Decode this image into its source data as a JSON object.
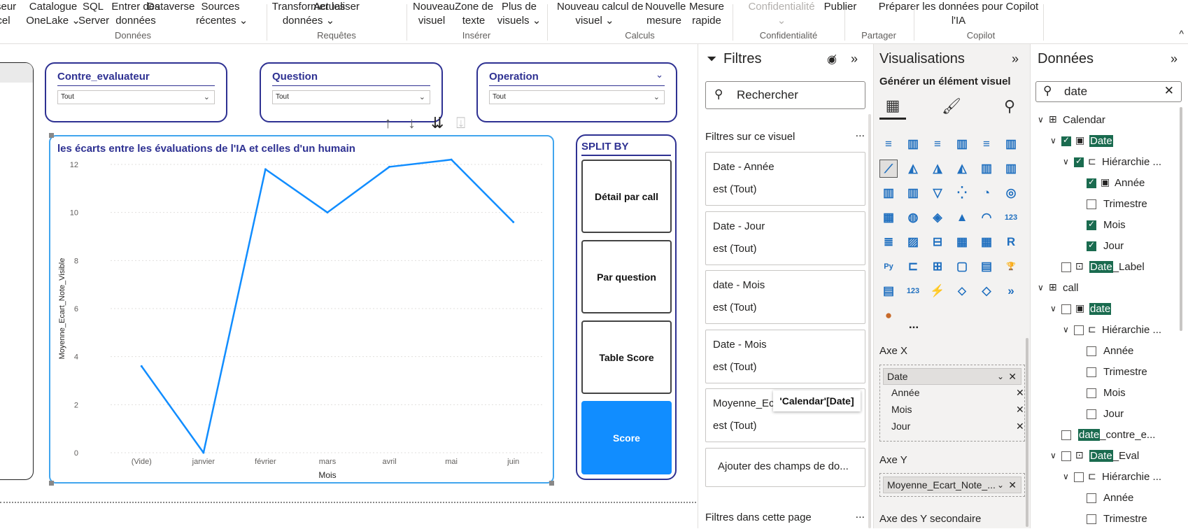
{
  "ribbon": {
    "items": [
      {
        "l1": "seur",
        "l2": "cel",
        "x": 0
      },
      {
        "l1": "Catalogue",
        "l2": "OneLake ⌄"
      },
      {
        "l1": "SQL",
        "l2": "Server"
      },
      {
        "l1": "Entrer des",
        "l2": "données"
      },
      {
        "l1": "Dataverse",
        "l2": ""
      },
      {
        "l1": "Sources",
        "l2": "récentes ⌄"
      },
      {
        "l1": "Transformer les",
        "l2": "données ⌄"
      },
      {
        "l1": "Actualiser",
        "l2": ""
      },
      {
        "l1": "Nouveau",
        "l2": "visuel"
      },
      {
        "l1": "Zone de",
        "l2": "texte"
      },
      {
        "l1": "Plus de",
        "l2": "visuels ⌄"
      },
      {
        "l1": "Nouveau calcul de",
        "l2": "visuel ⌄"
      },
      {
        "l1": "Nouvelle",
        "l2": "mesure"
      },
      {
        "l1": "Mesure",
        "l2": "rapide"
      },
      {
        "l1": "Confidentialité",
        "l2": "⌄"
      },
      {
        "l1": "Publier",
        "l2": ""
      },
      {
        "l1": "Préparer les données pour Copilot",
        "l2": "l'IA"
      }
    ],
    "groups": [
      "Données",
      "Requêtes",
      "Insérer",
      "Calculs",
      "Confidentialité",
      "Partager",
      "Copilot"
    ],
    "collapse_glyph": "^"
  },
  "slicers": [
    {
      "title": "Contre_evaluateur",
      "value": "Tout"
    },
    {
      "title": "Question",
      "value": "Tout"
    },
    {
      "title": "Operation",
      "value": "Tout"
    }
  ],
  "chart_data": {
    "type": "line",
    "title": "les écarts entre les évaluations de l'IA et celles d'un humain",
    "xlabel": "Mois",
    "ylabel": "Moyenne_Ecart_Note_Visible",
    "categories": [
      "(Vide)",
      "janvier",
      "février",
      "mars",
      "avril",
      "mai",
      "juin"
    ],
    "series": [
      {
        "values": [
          3.6,
          0.0,
          11.8,
          10.0,
          11.9,
          12.2,
          9.6
        ],
        "color": "#118dff"
      }
    ],
    "ylim": [
      0,
      12
    ],
    "yticks": [
      0,
      2,
      4,
      6,
      8,
      10,
      12
    ],
    "grid": true
  },
  "splitby": {
    "title": "SPLIT BY",
    "buttons": [
      "Détail par call",
      "Par question",
      "Table Score",
      "Score"
    ],
    "active_index": 3
  },
  "filters": {
    "title": "Filtres",
    "search_placeholder": "Rechercher",
    "section_visual": "Filtres sur ce visuel",
    "cards": [
      {
        "title": "Date - Année",
        "value": "est (Tout)"
      },
      {
        "title": "Date - Jour",
        "value": "est (Tout)"
      },
      {
        "title": "date - Mois",
        "value": "est (Tout)"
      },
      {
        "title": "Date - Mois",
        "value": "est (Tout)"
      },
      {
        "title": "Moyenne_Eca",
        "value": "est (Tout)"
      }
    ],
    "add_fields": "Ajouter des champs de do...",
    "section_page": "Filtres dans cette page",
    "ellipsis": "..."
  },
  "tooltip": "'Calendar'[Date]",
  "viz": {
    "title": "Visualisations",
    "subtitle": "Générer un élément visuel",
    "axis_x_label": "Axe X",
    "axis_x_field": "Date",
    "axis_x_subs": [
      "Année",
      "Mois",
      "Jour"
    ],
    "axis_y_label": "Axe Y",
    "axis_y_field": "Moyenne_Ecart_Note_...",
    "axis_y2_label": "Axe des Y secondaire",
    "more": "...",
    "icons": [
      "stacked-bar",
      "stacked-column",
      "clustered-bar",
      "clustered-column",
      "100-bar",
      "100-column",
      "line",
      "area",
      "stacked-area",
      "100-area",
      "line-column",
      "line-stacked",
      "ribbon",
      "waterfall",
      "funnel",
      "scatter",
      "pie",
      "donut",
      "treemap",
      "map",
      "filled-map",
      "azure-map",
      "gauge",
      "card",
      "multirow-card",
      "kpi",
      "slicer",
      "table",
      "matrix",
      "r-visual",
      "python",
      "key-influencers",
      "decomp-tree",
      "qa",
      "narrative",
      "metrics",
      "paginated",
      "new-card",
      "power-automate",
      "power-apps",
      "copilot",
      "arrow"
    ],
    "icon_glyphs": [
      "≡",
      "▥",
      "≡",
      "▥",
      "≡",
      "▥",
      "⟋",
      "◭",
      "◮",
      "◭",
      "▥",
      "▥",
      "▥",
      "▥",
      "▽",
      "⁛",
      "◔",
      "◎",
      "▦",
      "◍",
      "◈",
      "▲",
      "◠",
      "123",
      "≣",
      "▨",
      "⊟",
      "▦",
      "▦",
      "R",
      "Py",
      "⊏",
      "⊞",
      "▢",
      "▤",
      "🏆",
      "▤",
      "123",
      "⚡",
      "⬦",
      "◇",
      "»"
    ]
  },
  "data": {
    "title": "Données",
    "search_value": "date",
    "tree": [
      {
        "label": "Calendar",
        "level": 0,
        "kind": "table",
        "expand": true,
        "check": "none"
      },
      {
        "label": "Date",
        "level": 1,
        "kind": "field",
        "expand": true,
        "check": "on",
        "hl": true
      },
      {
        "label": "Hiérarchie ...",
        "level": 2,
        "kind": "hier",
        "expand": true,
        "check": "on"
      },
      {
        "label": "Année",
        "level": 3,
        "kind": "field",
        "check": "on"
      },
      {
        "label": "Trimestre",
        "level": 3,
        "kind": "plain",
        "check": "off"
      },
      {
        "label": "Mois",
        "level": 3,
        "kind": "plain",
        "check": "on"
      },
      {
        "label": "Jour",
        "level": 3,
        "kind": "plain",
        "check": "on"
      },
      {
        "label": "Date",
        "suffix": "_Label",
        "level": 1,
        "kind": "calc",
        "check": "off",
        "hl": true
      },
      {
        "label": "call",
        "level": 0,
        "kind": "table",
        "expand": true,
        "check": "none"
      },
      {
        "label": "date",
        "level": 1,
        "kind": "field",
        "expand": true,
        "check": "off",
        "hl": true
      },
      {
        "label": "Hiérarchie ...",
        "level": 2,
        "kind": "hier",
        "expand": true,
        "check": "off"
      },
      {
        "label": "Année",
        "level": 3,
        "kind": "plain",
        "check": "off"
      },
      {
        "label": "Trimestre",
        "level": 3,
        "kind": "plain",
        "check": "off"
      },
      {
        "label": "Mois",
        "level": 3,
        "kind": "plain",
        "check": "off"
      },
      {
        "label": "Jour",
        "level": 3,
        "kind": "plain",
        "check": "off"
      },
      {
        "label": "date",
        "suffix": "_contre_e...",
        "level": 1,
        "kind": "plain",
        "check": "off",
        "hl": true
      },
      {
        "label": "Date",
        "suffix": "_Eval",
        "level": 1,
        "kind": "calc",
        "expand": true,
        "check": "off",
        "hl": true
      },
      {
        "label": "Hiérarchie ...",
        "level": 2,
        "kind": "hier",
        "expand": true,
        "check": "off"
      },
      {
        "label": "Année",
        "level": 3,
        "kind": "plain",
        "check": "off"
      },
      {
        "label": "Trimestre",
        "level": 3,
        "kind": "plain",
        "check": "off"
      }
    ]
  }
}
